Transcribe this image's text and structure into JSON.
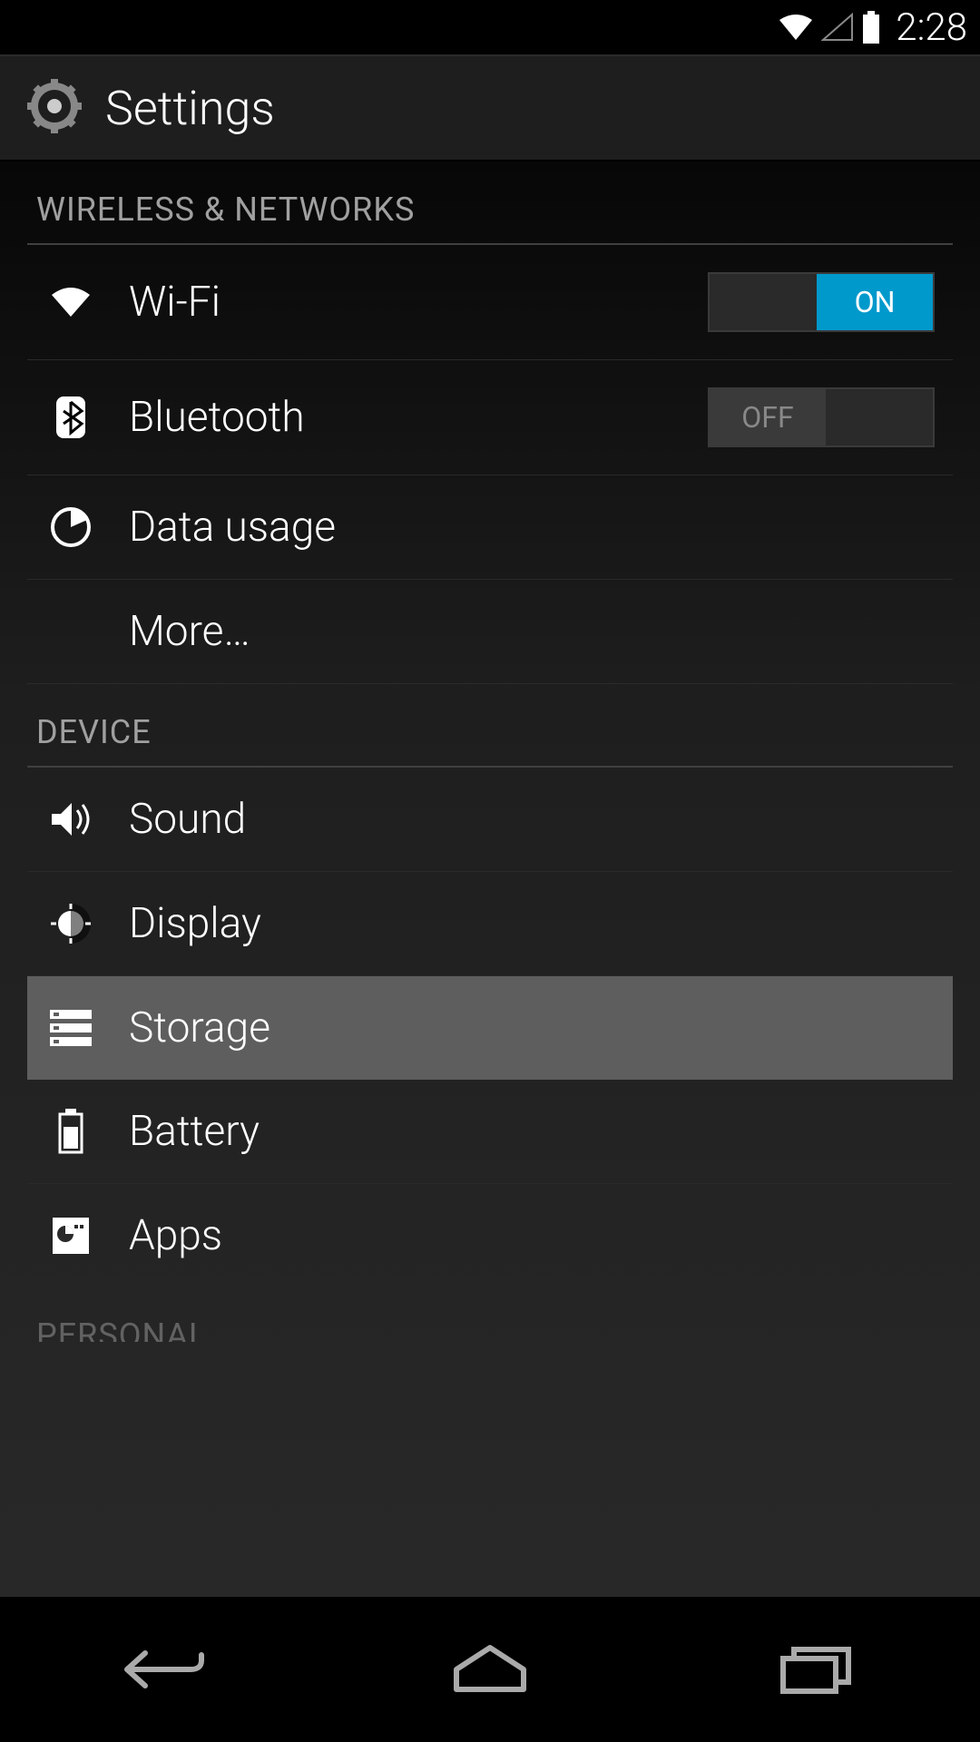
{
  "status_bar": {
    "time": "2:28"
  },
  "header": {
    "title": "Settings"
  },
  "sections": [
    {
      "title": "WIRELESS & NETWORKS",
      "items": [
        {
          "label": "Wi-Fi",
          "toggle": {
            "state": "ON",
            "on": true
          },
          "icon": "wifi"
        },
        {
          "label": "Bluetooth",
          "toggle": {
            "state": "OFF",
            "on": false
          },
          "icon": "bluetooth"
        },
        {
          "label": "Data usage",
          "icon": "datausage"
        },
        {
          "label": "More…",
          "icon": ""
        }
      ]
    },
    {
      "title": "DEVICE",
      "items": [
        {
          "label": "Sound",
          "icon": "sound"
        },
        {
          "label": "Display",
          "icon": "display"
        },
        {
          "label": "Storage",
          "icon": "storage",
          "selected": true
        },
        {
          "label": "Battery",
          "icon": "battery"
        },
        {
          "label": "Apps",
          "icon": "apps"
        }
      ]
    },
    {
      "title": "PERSONAL",
      "partial": true,
      "items": []
    }
  ]
}
